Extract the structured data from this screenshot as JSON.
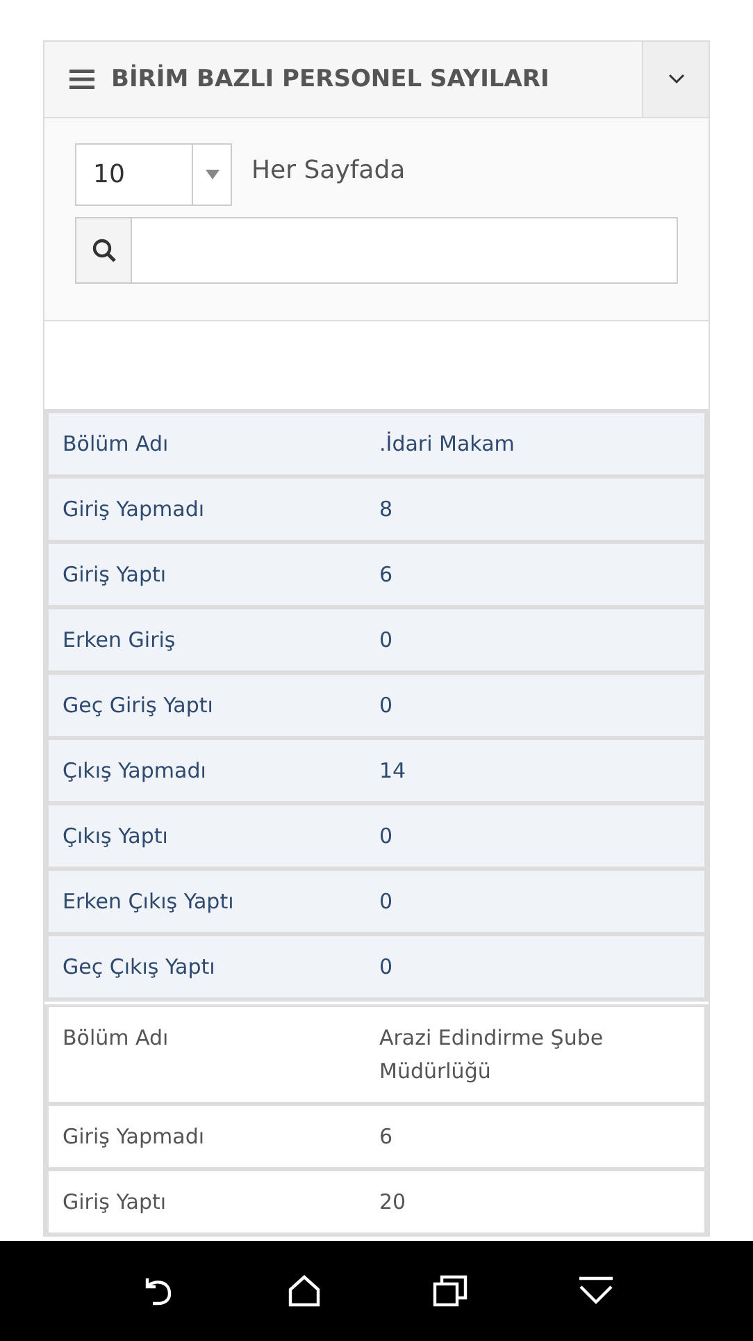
{
  "panel": {
    "title": "BİRİM BAZLI PERSONEL SAYILARI"
  },
  "page_size": {
    "value": "10",
    "label": "Her Sayfada"
  },
  "records": [
    {
      "selected": true,
      "rows": [
        {
          "label": "Bölüm Adı",
          "value": ".İdari Makam"
        },
        {
          "label": "Giriş Yapmadı",
          "value": "8"
        },
        {
          "label": "Giriş Yaptı",
          "value": "6"
        },
        {
          "label": "Erken Giriş",
          "value": "0"
        },
        {
          "label": "Geç Giriş Yaptı",
          "value": "0"
        },
        {
          "label": "Çıkış Yapmadı",
          "value": "14"
        },
        {
          "label": "Çıkış Yaptı",
          "value": "0"
        },
        {
          "label": "Erken Çıkış Yaptı",
          "value": "0"
        },
        {
          "label": "Geç Çıkış Yaptı",
          "value": "0"
        }
      ]
    },
    {
      "selected": false,
      "rows": [
        {
          "label": "Bölüm Adı",
          "value": "Arazi Edindirme Şube Müdürlüğü"
        },
        {
          "label": "Giriş Yapmadı",
          "value": "6"
        },
        {
          "label": "Giriş Yaptı",
          "value": "20"
        }
      ]
    }
  ]
}
